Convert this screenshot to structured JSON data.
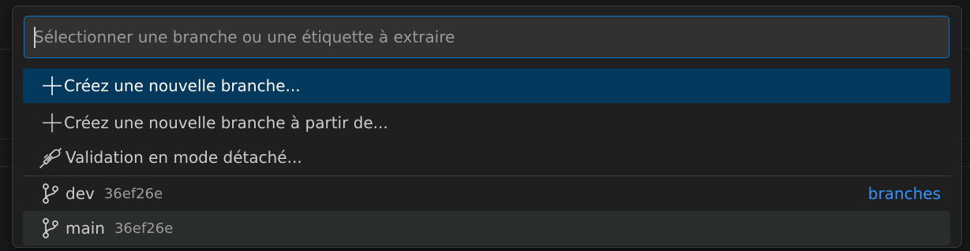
{
  "quick_pick": {
    "input": {
      "value": "",
      "placeholder": "Sélectionner une branche ou une étiquette à extraire"
    },
    "actions": [
      {
        "icon": "plus-icon",
        "label": "Créez une nouvelle branche..."
      },
      {
        "icon": "plus-icon",
        "label": "Créez une nouvelle branche à partir de..."
      },
      {
        "icon": "debug-disconnect-icon",
        "label": "Validation en mode détaché..."
      }
    ],
    "branches": [
      {
        "icon": "git-branch-icon",
        "name": "dev",
        "commit": "36ef26e",
        "group": "branches"
      },
      {
        "icon": "git-branch-icon",
        "name": "main",
        "commit": "36ef26e",
        "group": ""
      }
    ]
  },
  "colors": {
    "accent": "#0078d4",
    "selected_row": "#04395e",
    "group_label": "#3794ff"
  }
}
